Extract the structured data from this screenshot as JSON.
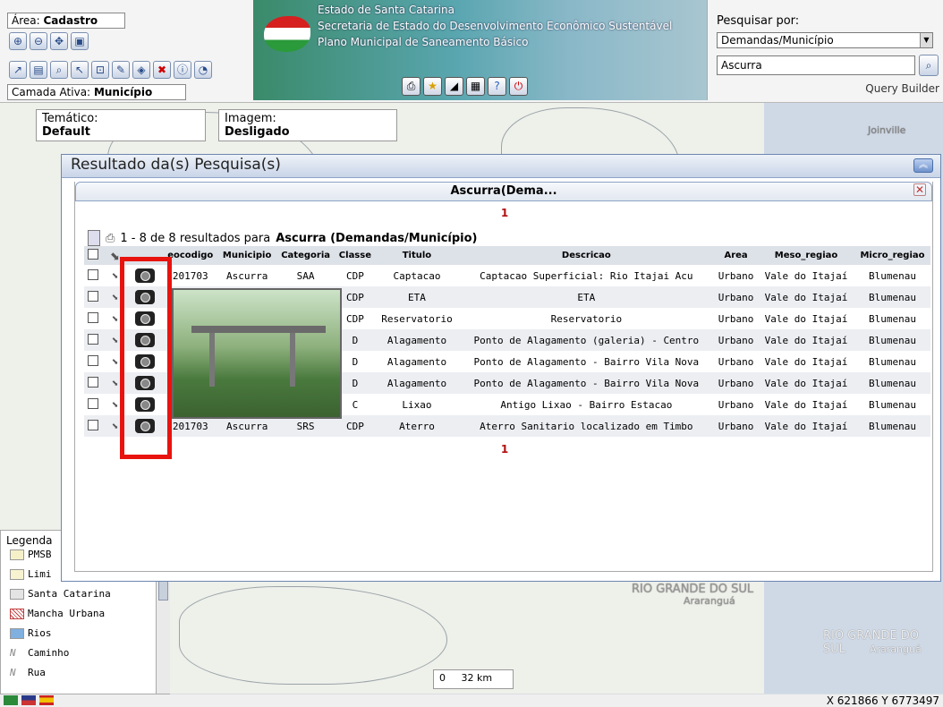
{
  "area": {
    "label": "Área:",
    "value": "Cadastro"
  },
  "layer": {
    "label": "Camada Ativa:",
    "value": "Município"
  },
  "banner": {
    "line1": "Estado de Santa Catarina",
    "line2": "Secretaria de Estado do Desenvolvimento Econômico Sustentável",
    "line3": "Plano Municipal de Saneamento Básico"
  },
  "search": {
    "label": "Pesquisar por:",
    "selected": "Demandas/Município",
    "value": "Ascurra",
    "query_builder": "Query Builder"
  },
  "tematico": {
    "label": "Temático:",
    "value": "Default"
  },
  "imagem": {
    "label": "Imagem:",
    "value": "Desligado"
  },
  "result": {
    "title": "Resultado da(s) Pesquisa(s)",
    "subtitle": "Ascurra(Dema...",
    "page": "1",
    "count_prefix": "1 - 8 de 8 resultados para",
    "count_query": "Ascurra (Demandas/Município)",
    "columns": [
      "eocodigo",
      "Municipio",
      "Categoria",
      "Classe",
      "Titulo",
      "Descricao",
      "Area",
      "Meso_regiao",
      "Micro_regiao"
    ],
    "rows": [
      [
        "201703",
        "Ascurra",
        "SAA",
        "CDP",
        "Captacao",
        "Captacao Superficial: Rio Itajai Acu",
        "Urbano",
        "Vale do Itajaí",
        "Blumenau"
      ],
      [
        "",
        "",
        "",
        "CDP",
        "ETA",
        "ETA",
        "Urbano",
        "Vale do Itajaí",
        "Blumenau"
      ],
      [
        "",
        "",
        "",
        "CDP",
        "Reservatorio",
        "Reservatorio",
        "Urbano",
        "Vale do Itajaí",
        "Blumenau"
      ],
      [
        "",
        "",
        "",
        "D",
        "Alagamento",
        "Ponto de Alagamento (galeria) - Centro",
        "Urbano",
        "Vale do Itajaí",
        "Blumenau"
      ],
      [
        "",
        "",
        "",
        "D",
        "Alagamento",
        "Ponto de Alagamento - Bairro Vila Nova",
        "Urbano",
        "Vale do Itajaí",
        "Blumenau"
      ],
      [
        "",
        "",
        "",
        "D",
        "Alagamento",
        "Ponto de Alagamento - Bairro Vila Nova",
        "Urbano",
        "Vale do Itajaí",
        "Blumenau"
      ],
      [
        "",
        "",
        "",
        "C",
        "Lixao",
        "Antigo Lixao - Bairro Estacao",
        "Urbano",
        "Vale do Itajaí",
        "Blumenau"
      ],
      [
        "201703",
        "Ascurra",
        "SRS",
        "CDP",
        "Aterro",
        "Aterro Sanitario localizado em Timbo",
        "Urbano",
        "Vale do Itajaí",
        "Blumenau"
      ]
    ]
  },
  "legend": {
    "title": "Legenda",
    "items": [
      {
        "label": "PMSB",
        "color": "#f5f0c8"
      },
      {
        "label": "Limi",
        "color": "#f7f3d0"
      },
      {
        "label": "Santa Catarina",
        "color": "#e4e4e4"
      },
      {
        "label": "Mancha Urbana",
        "color": "#ffffff"
      },
      {
        "label": "Rios",
        "color": "#7fb0e0"
      },
      {
        "label": "Caminho",
        "color": "#ffffff"
      },
      {
        "label": "Rua",
        "color": "#ffffff"
      }
    ]
  },
  "map": {
    "labels": [
      "RIO GRANDE DO SUL",
      "Araranguá",
      "Joinville",
      "RIO GRANDE DO SUL",
      "Araranguá"
    ],
    "scale_label": "32 km",
    "scale_zero": "0"
  },
  "status": {
    "coords": "X 621866 Y 6773497"
  }
}
